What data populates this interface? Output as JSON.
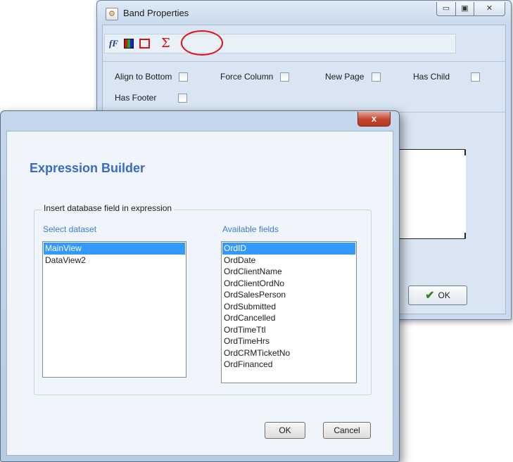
{
  "band_properties": {
    "title": "Band Properties",
    "caption_buttons": {
      "minimize": "▭",
      "maximize": "▣",
      "close": "✕"
    },
    "toolbar": {
      "font_icon": "fF",
      "color_icon": "color-grid-icon",
      "rect_icon": "frame-icon",
      "sigma_icon": "Σ"
    },
    "options": {
      "align_to_bottom": "Align to Bottom",
      "force_column": "Force Column",
      "new_page": "New Page",
      "has_child": "Has Child",
      "has_footer": "Has Footer"
    },
    "ok_label": "OK"
  },
  "expression_builder": {
    "close_label": "x",
    "heading": "Expression Builder",
    "group_label": "Insert database field in expression",
    "dataset_label": "Select dataset",
    "fields_label": "Available fields",
    "datasets": [
      {
        "name": "MainView",
        "selected": true
      },
      {
        "name": "DataView2",
        "selected": false
      }
    ],
    "fields": [
      {
        "name": "OrdID",
        "selected": true
      },
      {
        "name": "OrdDate",
        "selected": false
      },
      {
        "name": "OrdClientName",
        "selected": false
      },
      {
        "name": "OrdClientOrdNo",
        "selected": false
      },
      {
        "name": "OrdSalesPerson",
        "selected": false
      },
      {
        "name": "OrdSubmitted",
        "selected": false
      },
      {
        "name": "OrdCancelled",
        "selected": false
      },
      {
        "name": "OrdTimeTtl",
        "selected": false
      },
      {
        "name": "OrdTimeHrs",
        "selected": false
      },
      {
        "name": "OrdCRMTicketNo",
        "selected": false
      },
      {
        "name": "OrdFinanced",
        "selected": false
      }
    ],
    "ok_label": "OK",
    "cancel_label": "Cancel"
  },
  "colors": {
    "selection": "#3399ff",
    "heading": "#3a6ac9",
    "column_label": "#3d7ad3",
    "highlight_ring": "#e01010"
  }
}
